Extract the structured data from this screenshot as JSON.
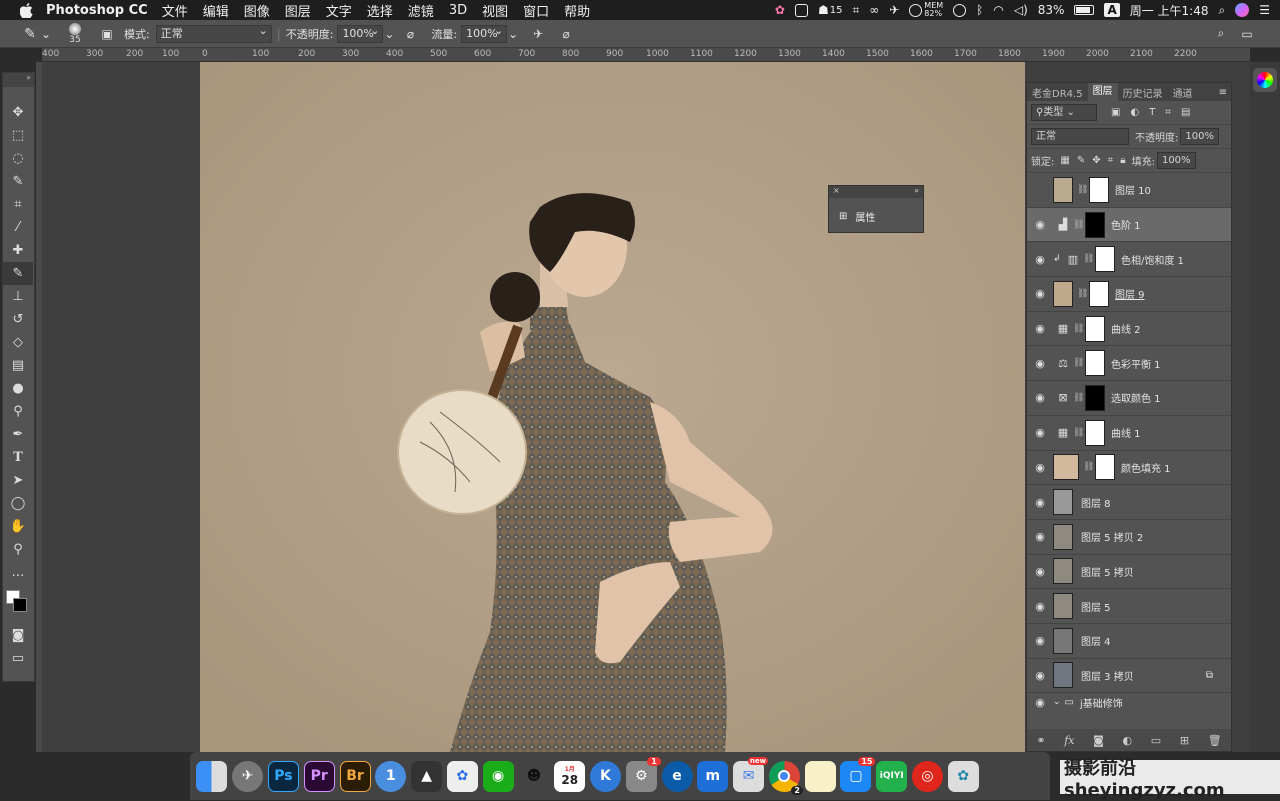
{
  "menubar": {
    "app_name": "Photoshop CC",
    "menus": [
      "文件",
      "编辑",
      "图像",
      "图层",
      "文字",
      "选择",
      "滤镜",
      "3D",
      "视图",
      "窗口",
      "帮助"
    ],
    "status": {
      "notif_count": "15",
      "mem_label": "MEM",
      "mem_value": "82%",
      "battery": "83%",
      "input": "A",
      "clock": "周一 上午1:48"
    }
  },
  "options_bar": {
    "brush_size": "35",
    "mode_label": "模式:",
    "mode_value": "正常",
    "opacity_label": "不透明度:",
    "opacity_value": "100%",
    "flow_label": "流量:",
    "flow_value": "100%"
  },
  "ruler": {
    "ticks": [
      "400",
      "300",
      "200",
      "100",
      "0",
      "100",
      "200",
      "300",
      "400",
      "500",
      "600",
      "700",
      "800",
      "900",
      "1000",
      "1100",
      "1200",
      "1300",
      "1400",
      "1500",
      "1600",
      "1700",
      "1800",
      "1900",
      "2000",
      "2100",
      "2200"
    ]
  },
  "properties": {
    "title": "属性"
  },
  "layers_panel": {
    "tabs": [
      "老金DR4.5",
      "图层",
      "历史记录",
      "通道"
    ],
    "filter_label": "类型",
    "blend": "正常",
    "opacity_label": "不透明度:",
    "opacity_value": "100%",
    "lock_label": "锁定:",
    "fill_label": "填充:",
    "fill_value": "100%",
    "layers": [
      {
        "name": "图层 10"
      },
      {
        "name": "色阶 1"
      },
      {
        "name": "色相/饱和度 1"
      },
      {
        "name": "图层 9"
      },
      {
        "name": "曲线 2"
      },
      {
        "name": "色彩平衡 1"
      },
      {
        "name": "选取颜色 1"
      },
      {
        "name": "曲线 1"
      },
      {
        "name": "颜色填充 1"
      },
      {
        "name": "图层 8"
      },
      {
        "name": "图层 5 拷贝 2"
      },
      {
        "name": "图层 5 拷贝"
      },
      {
        "name": "图层 5"
      },
      {
        "name": "图层 4"
      },
      {
        "name": "图层 3 拷贝"
      },
      {
        "name": "j基础修饰"
      }
    ]
  },
  "dock": {
    "calendar_day": "28",
    "calendar_month": "1月",
    "badge_1": "1",
    "badge_2": "15",
    "badge_new": "new",
    "badge_chrome": "2"
  },
  "watermark": {
    "text": "摄影前沿 sheyingzyz.com"
  },
  "colors": {
    "canvas_bg": "#b7a48c",
    "panel": "#535353",
    "menubar": "#1e1e1e"
  }
}
